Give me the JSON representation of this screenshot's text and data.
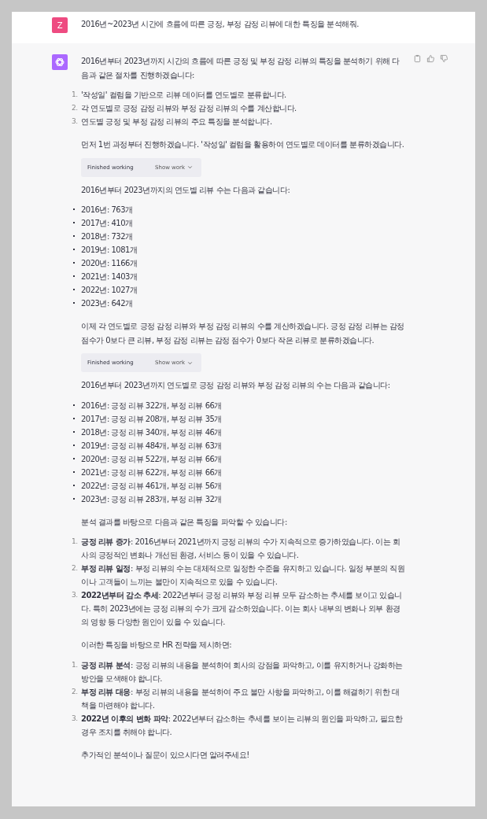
{
  "user_message": {
    "avatar": "Z",
    "text": "2016년~2023년 시간에 흐름에 따른 긍정, 부정 감정 리뷰에 대한 특징을 분석해줘."
  },
  "assistant_message": {
    "blocks": [
      {
        "kind": "paragraph",
        "text": "2016년부터 2023년까지 시간의 흐름에 따른 긍정 및 부정 감정 리뷰의 특징을 분석하기 위해 다음과 같은 절차를 진행하겠습니다:"
      },
      {
        "kind": "ordered",
        "items": [
          {
            "number": "1.",
            "text": "'작성일' 컬럼을 기반으로 리뷰 데이터를 연도별로 분류합니다."
          },
          {
            "number": "2.",
            "text": "각 연도별로 긍정 감정 리뷰와 부정 감정 리뷰의 수를 계산합니다."
          },
          {
            "number": "3.",
            "text": "연도별 긍정 및 부정 감정 리뷰의 주요 특징을 분석합니다."
          }
        ]
      },
      {
        "kind": "paragraph",
        "text": "먼저 1번 과정부터 진행하겠습니다. '작성일' 컬럼을 활용하여 연도별로 데이터를 분류하겠습니다."
      },
      {
        "kind": "tool",
        "status": "Finished working",
        "action": "Show work"
      },
      {
        "kind": "paragraph",
        "text": "2016년부터 2023년까지의 연도별 리뷰 수는 다음과 같습니다:"
      },
      {
        "kind": "bullets",
        "items": [
          "2016년: 763개",
          "2017년: 410개",
          "2018년: 732개",
          "2019년: 1081개",
          "2020년: 1166개",
          "2021년: 1403개",
          "2022년: 1027개",
          "2023년: 642개"
        ]
      },
      {
        "kind": "paragraph",
        "text": "이제 각 연도별로 긍정 감정 리뷰와 부정 감정 리뷰의 수를 계산하겠습니다. 긍정 감정 리뷰는 감정 점수가 0보다 큰 리뷰, 부정 감정 리뷰는 감정 점수가 0보다 작은 리뷰로 분류하겠습니다."
      },
      {
        "kind": "tool",
        "status": "Finished working",
        "action": "Show work"
      },
      {
        "kind": "paragraph",
        "text": "2016년부터 2023년까지 연도별로 긍정 감정 리뷰와 부정 감정 리뷰의 수는 다음과 같습니다:"
      },
      {
        "kind": "bullets",
        "items": [
          "2016년: 긍정 리뷰 322개, 부정 리뷰 66개",
          "2017년: 긍정 리뷰 208개, 부정 리뷰 35개",
          "2018년: 긍정 리뷰 340개, 부정 리뷰 46개",
          "2019년: 긍정 리뷰 484개, 부정 리뷰 63개",
          "2020년: 긍정 리뷰 522개, 부정 리뷰 66개",
          "2021년: 긍정 리뷰 622개, 부정 리뷰 66개",
          "2022년: 긍정 리뷰 461개, 부정 리뷰 56개",
          "2023년: 긍정 리뷰 283개, 부정 리뷰 32개"
        ]
      },
      {
        "kind": "paragraph",
        "text": "분석 결과를 바탕으로 다음과 같은 특징을 파악할 수 있습니다:"
      },
      {
        "kind": "ordered",
        "items": [
          {
            "number": "1.",
            "text": "**긍정 리뷰 증가**: 2016년부터 2021년까지 긍정 리뷰의 수가 지속적으로 증가하였습니다. 이는 회사의 긍정적인 변화나 개선된 환경, 서비스 등이 있을 수 있습니다."
          },
          {
            "number": "2.",
            "text": "**부정 리뷰 일정**: 부정 리뷰의 수는 대체적으로 일정한 수준을 유지하고 있습니다. 일정 부분의 직원이나 고객들이 느끼는 불만이 지속적으로 있을 수 있습니다."
          },
          {
            "number": "3.",
            "text": "**2022년부터 감소 추세**: 2022년부터 긍정 리뷰와 부정 리뷰 모두 감소하는 추세를 보이고 있습니다. 특히 2023년에는 긍정 리뷰의 수가 크게 감소하였습니다. 이는 회사 내부의 변화나 외부 환경의 영향 등 다양한 원인이 있을 수 있습니다."
          }
        ]
      },
      {
        "kind": "paragraph",
        "text": "이러한 특징을 바탕으로 HR 전략을 제시하면:"
      },
      {
        "kind": "ordered",
        "items": [
          {
            "number": "1.",
            "text": "**긍정 리뷰 분석**: 긍정 리뷰의 내용을 분석하여 회사의 강점을 파악하고, 이를 유지하거나 강화하는 방안을 모색해야 합니다."
          },
          {
            "number": "2.",
            "text": "**부정 리뷰 대응**: 부정 리뷰의 내용을 분석하여 주요 불만 사항을 파악하고, 이를 해결하기 위한 대책을 마련해야 합니다."
          },
          {
            "number": "3.",
            "text": "**2022년 이후의 변화 파악**: 2022년부터 감소하는 추세를 보이는 리뷰의 원인을 파악하고, 필요한 경우 조치를 취해야 합니다."
          }
        ]
      },
      {
        "kind": "paragraph",
        "text": "추가적인 분석이나 질문이 있으시다면 알려주세요!"
      }
    ]
  }
}
